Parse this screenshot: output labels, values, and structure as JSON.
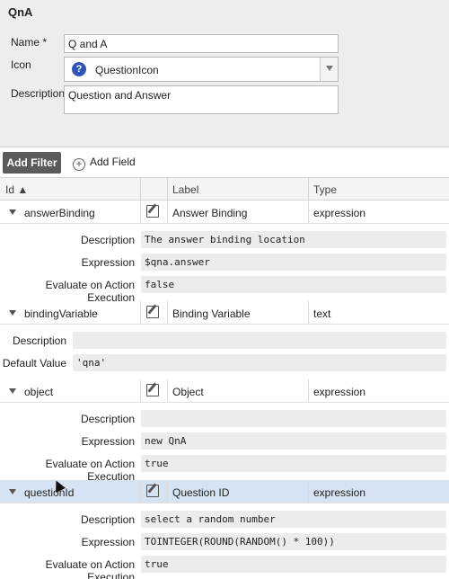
{
  "form": {
    "title": "QnA",
    "name_label": "Name *",
    "name_value": "Q and A",
    "icon_label": "Icon",
    "icon_value": "QuestionIcon",
    "description_label": "Description",
    "description_value": "Question and Answer"
  },
  "toolbar": {
    "add_filter": "Add Filter",
    "add_field": "Add Field"
  },
  "table": {
    "headers": {
      "id": "Id ▲",
      "label": "Label",
      "type": "Type"
    },
    "rows": [
      {
        "id": "answerBinding",
        "label": "Answer Binding",
        "type": "expression",
        "details": [
          {
            "label": "Description",
            "value": "The answer binding location"
          },
          {
            "label": "Expression",
            "value": "$qna.answer"
          },
          {
            "label": "Evaluate on Action Execution",
            "value": "false"
          }
        ]
      },
      {
        "id": "bindingVariable",
        "label": "Binding Variable",
        "type": "text",
        "details": [
          {
            "label": "Description",
            "value": ""
          },
          {
            "label": "Default Value",
            "value": "'qna'"
          }
        ]
      },
      {
        "id": "object",
        "label": "Object",
        "type": "expression",
        "details": [
          {
            "label": "Description",
            "value": ""
          },
          {
            "label": "Expression",
            "value": "new QnA"
          },
          {
            "label": "Evaluate on Action Execution",
            "value": "true"
          }
        ]
      },
      {
        "id": "questionId",
        "label": "Question ID",
        "type": "expression",
        "details": [
          {
            "label": "Description",
            "value": "select a random number"
          },
          {
            "label": "Expression",
            "value": "TOINTEGER(ROUND(RANDOM() * 100))"
          },
          {
            "label": "Evaluate on Action Execution",
            "value": "true"
          }
        ]
      }
    ]
  }
}
